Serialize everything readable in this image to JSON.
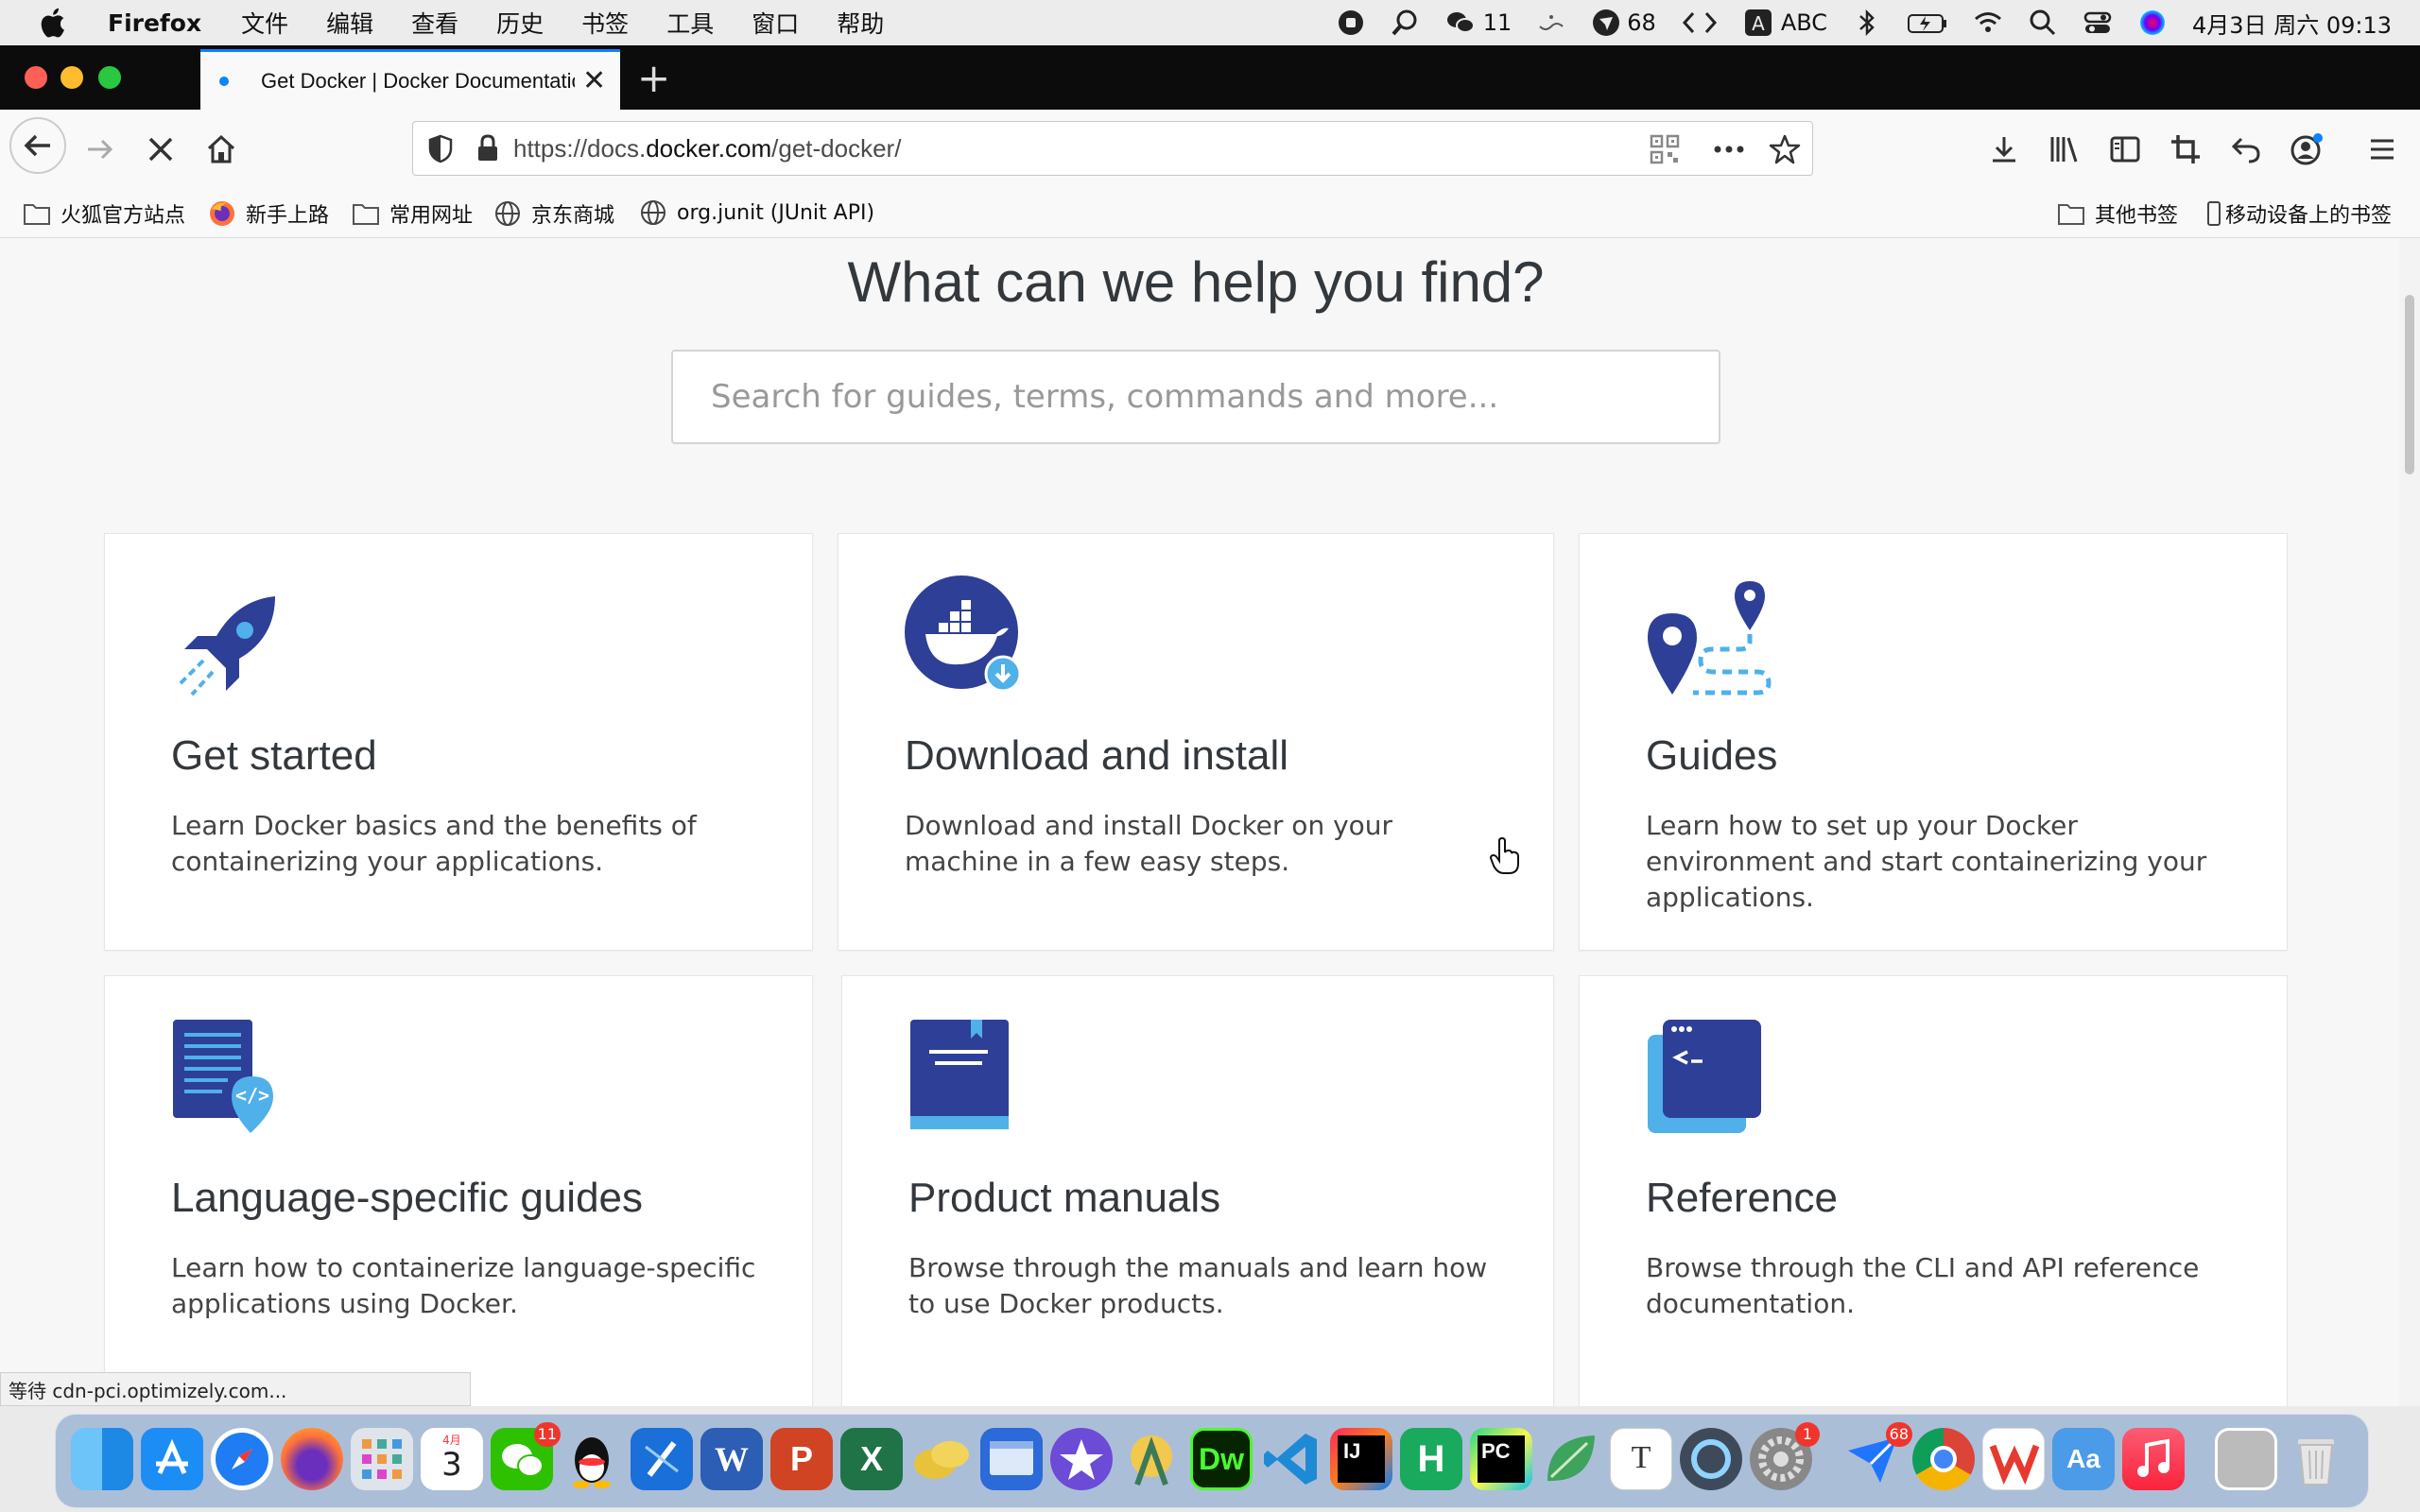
{
  "menubar": {
    "app": "Firefox",
    "menus": [
      "文件",
      "编辑",
      "查看",
      "历史",
      "书签",
      "工具",
      "窗口",
      "帮助"
    ],
    "wechat_count": "11",
    "badge_count": "68",
    "input_method": "ABC",
    "datetime": "4月3日 周六  09:13"
  },
  "browser": {
    "tab_title": "Get Docker | Docker Documentation",
    "url_prefix": "https://docs.",
    "url_domain": "docker.com",
    "url_path": "/get-docker/",
    "bookmarks": [
      "火狐官方站点",
      "新手上路",
      "常用网址",
      "京东商城",
      "org.junit (JUnit API)"
    ],
    "other_bookmarks": "其他书签",
    "mobile_bookmarks": "移动设备上的书签",
    "status_text": "等待 cdn-pci.optimizely.com..."
  },
  "page": {
    "headline": "What can we help you find?",
    "search_placeholder": "Search for guides, terms, commands and more...",
    "cards": [
      {
        "title": "Get started",
        "desc": "Learn Docker basics and the benefits of containerizing your applications.",
        "icon": "rocket-icon"
      },
      {
        "title": "Download and install",
        "desc": "Download and install Docker on your machine in a few easy steps.",
        "icon": "docker-whale-icon"
      },
      {
        "title": "Guides",
        "desc": "Learn how to set up your Docker environment and start containerizing your applications.",
        "icon": "map-pins-icon"
      },
      {
        "title": "Language-specific guides",
        "desc": "Learn how to containerize language-specific applications using Docker.",
        "icon": "code-document-icon"
      },
      {
        "title": "Product manuals",
        "desc": "Browse through the manuals and learn how to use Docker products.",
        "icon": "book-icon"
      },
      {
        "title": "Reference",
        "desc": "Browse through the CLI and API reference documentation.",
        "icon": "terminal-icon"
      }
    ]
  },
  "dock": {
    "apps": [
      "Finder",
      "App Store",
      "Safari",
      "Firefox",
      "Launchpad",
      "Calendar",
      "WeChat",
      "QQ",
      "Xcode",
      "Word",
      "PowerPoint",
      "Excel",
      "Notes",
      "Simulator",
      "iMovie",
      "Android Studio",
      "Dreamweaver",
      "VS Code",
      "IntelliJ IDEA",
      "HBuilder",
      "PyCharm",
      "Leaf",
      "Typora",
      "Proxy",
      "System Preferences",
      "Feishu",
      "Chrome",
      "WPS",
      "Dictionary",
      "Music",
      "Screenshot",
      "Trash"
    ],
    "calendar_month": "4月",
    "calendar_day": "3",
    "wechat_badge": "11",
    "prefs_badge": "1",
    "feishu_badge": "68"
  },
  "colors": {
    "docker_dark": "#2d3f96",
    "docker_light": "#4fb0ea",
    "docker_blue": "#1d63ed",
    "firefox_accent": "#0a84ff"
  }
}
